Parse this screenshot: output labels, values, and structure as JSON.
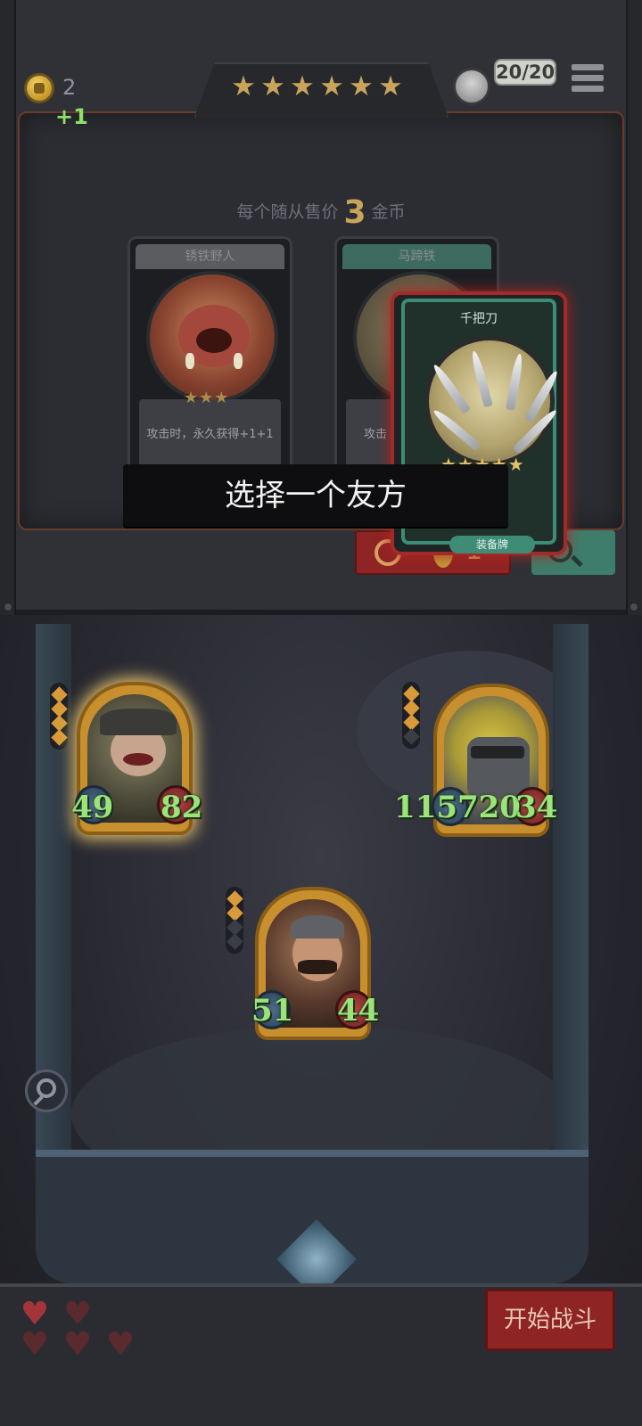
{
  "header": {
    "gold": "2",
    "gold_income": "+1",
    "tier_stars": 6,
    "health": "20/20"
  },
  "shop": {
    "price_prefix": "每个随从售价",
    "price_value": "3",
    "price_suffix": "金币",
    "cards": [
      {
        "name": "锈铁野人",
        "stars": "★★★",
        "text": "攻击时，永久获得+1+1"
      },
      {
        "name": "马蹄铁",
        "stars": "★★",
        "text": "攻击"
      }
    ],
    "selected_card": {
      "name": "千把刀",
      "stars": "★★★★★",
      "type": "装备牌"
    },
    "buy_button": {
      "cost": "1"
    }
  },
  "prompt": {
    "text": "选择一个友方"
  },
  "board": {
    "units": [
      {
        "attack": "49",
        "health": "82",
        "tier_pips": 4
      },
      {
        "attack": "115720",
        "health": "34",
        "tier_pips": 3
      },
      {
        "attack": "51",
        "health": "44",
        "tier_pips": 2
      }
    ]
  },
  "footer": {
    "lives_full": 1,
    "lives_total": 5,
    "start_button": "开始战斗"
  },
  "colors": {
    "accent_gold": "#c9a45b",
    "button_red": "#8e2424",
    "stat_green": "#9be37b",
    "equip_teal": "#3f8c76"
  }
}
